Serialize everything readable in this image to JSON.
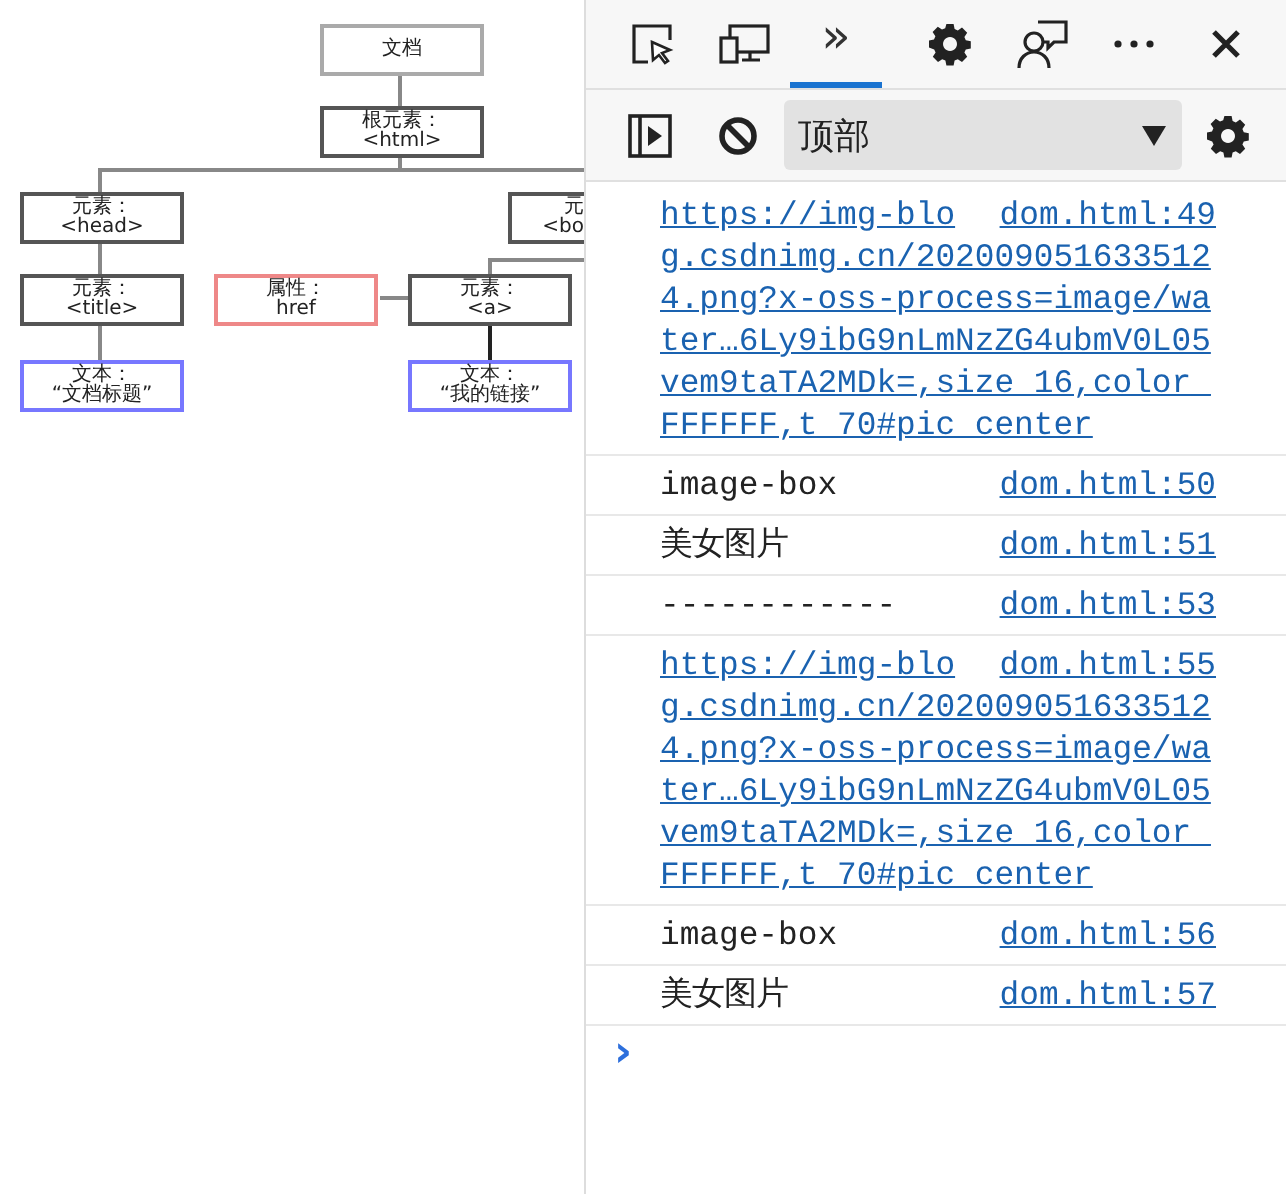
{
  "page": {
    "diagram": {
      "nodes": [
        {
          "kind": "plain",
          "lines": [
            "文档"
          ]
        },
        {
          "kind": "element",
          "lines": [
            "根元素：",
            "<html>"
          ]
        },
        {
          "kind": "element",
          "lines": [
            "元素：",
            "<head>"
          ]
        },
        {
          "kind": "element",
          "lines": [
            "元",
            "<bo"
          ]
        },
        {
          "kind": "element",
          "lines": [
            "元素：",
            "<title>"
          ]
        },
        {
          "kind": "attribute",
          "lines": [
            "属性：",
            "href"
          ]
        },
        {
          "kind": "element",
          "lines": [
            "元素：",
            "<a>"
          ]
        },
        {
          "kind": "text",
          "lines": [
            "文本：",
            "“文档标题”"
          ]
        },
        {
          "kind": "text",
          "lines": [
            "文本：",
            "“我的链接”"
          ]
        }
      ]
    }
  },
  "devtools": {
    "tabs": [
      {
        "label": "»",
        "selected": true
      }
    ],
    "context": {
      "value": "顶部"
    },
    "messages": [
      {
        "kind": "link",
        "text": "https://img-blog.csdnimg.cn/2020090516335124.png?x-oss-process=image/water…6Ly9ibG9nLmNzZG4ubmV0L05vem9taTA2MDk=,size_16,color_FFFFFF,t_70#pic_center",
        "source": "dom.html:49"
      },
      {
        "kind": "text",
        "text": "image-box",
        "source": "dom.html:50"
      },
      {
        "kind": "text",
        "text": "美女图片",
        "source": "dom.html:51"
      },
      {
        "kind": "text",
        "text": "------------",
        "source": "dom.html:53"
      },
      {
        "kind": "link",
        "text": "https://img-blog.csdnimg.cn/2020090516335124.png?x-oss-process=image/water…6Ly9ibG9nLmNzZG4ubmV0L05vem9taTA2MDk=,size_16,color_FFFFFF,t_70#pic_center",
        "source": "dom.html:55"
      },
      {
        "kind": "text",
        "text": "image-box",
        "source": "dom.html:56"
      },
      {
        "kind": "text",
        "text": "美女图片",
        "source": "dom.html:57"
      }
    ],
    "prompt": "›"
  }
}
